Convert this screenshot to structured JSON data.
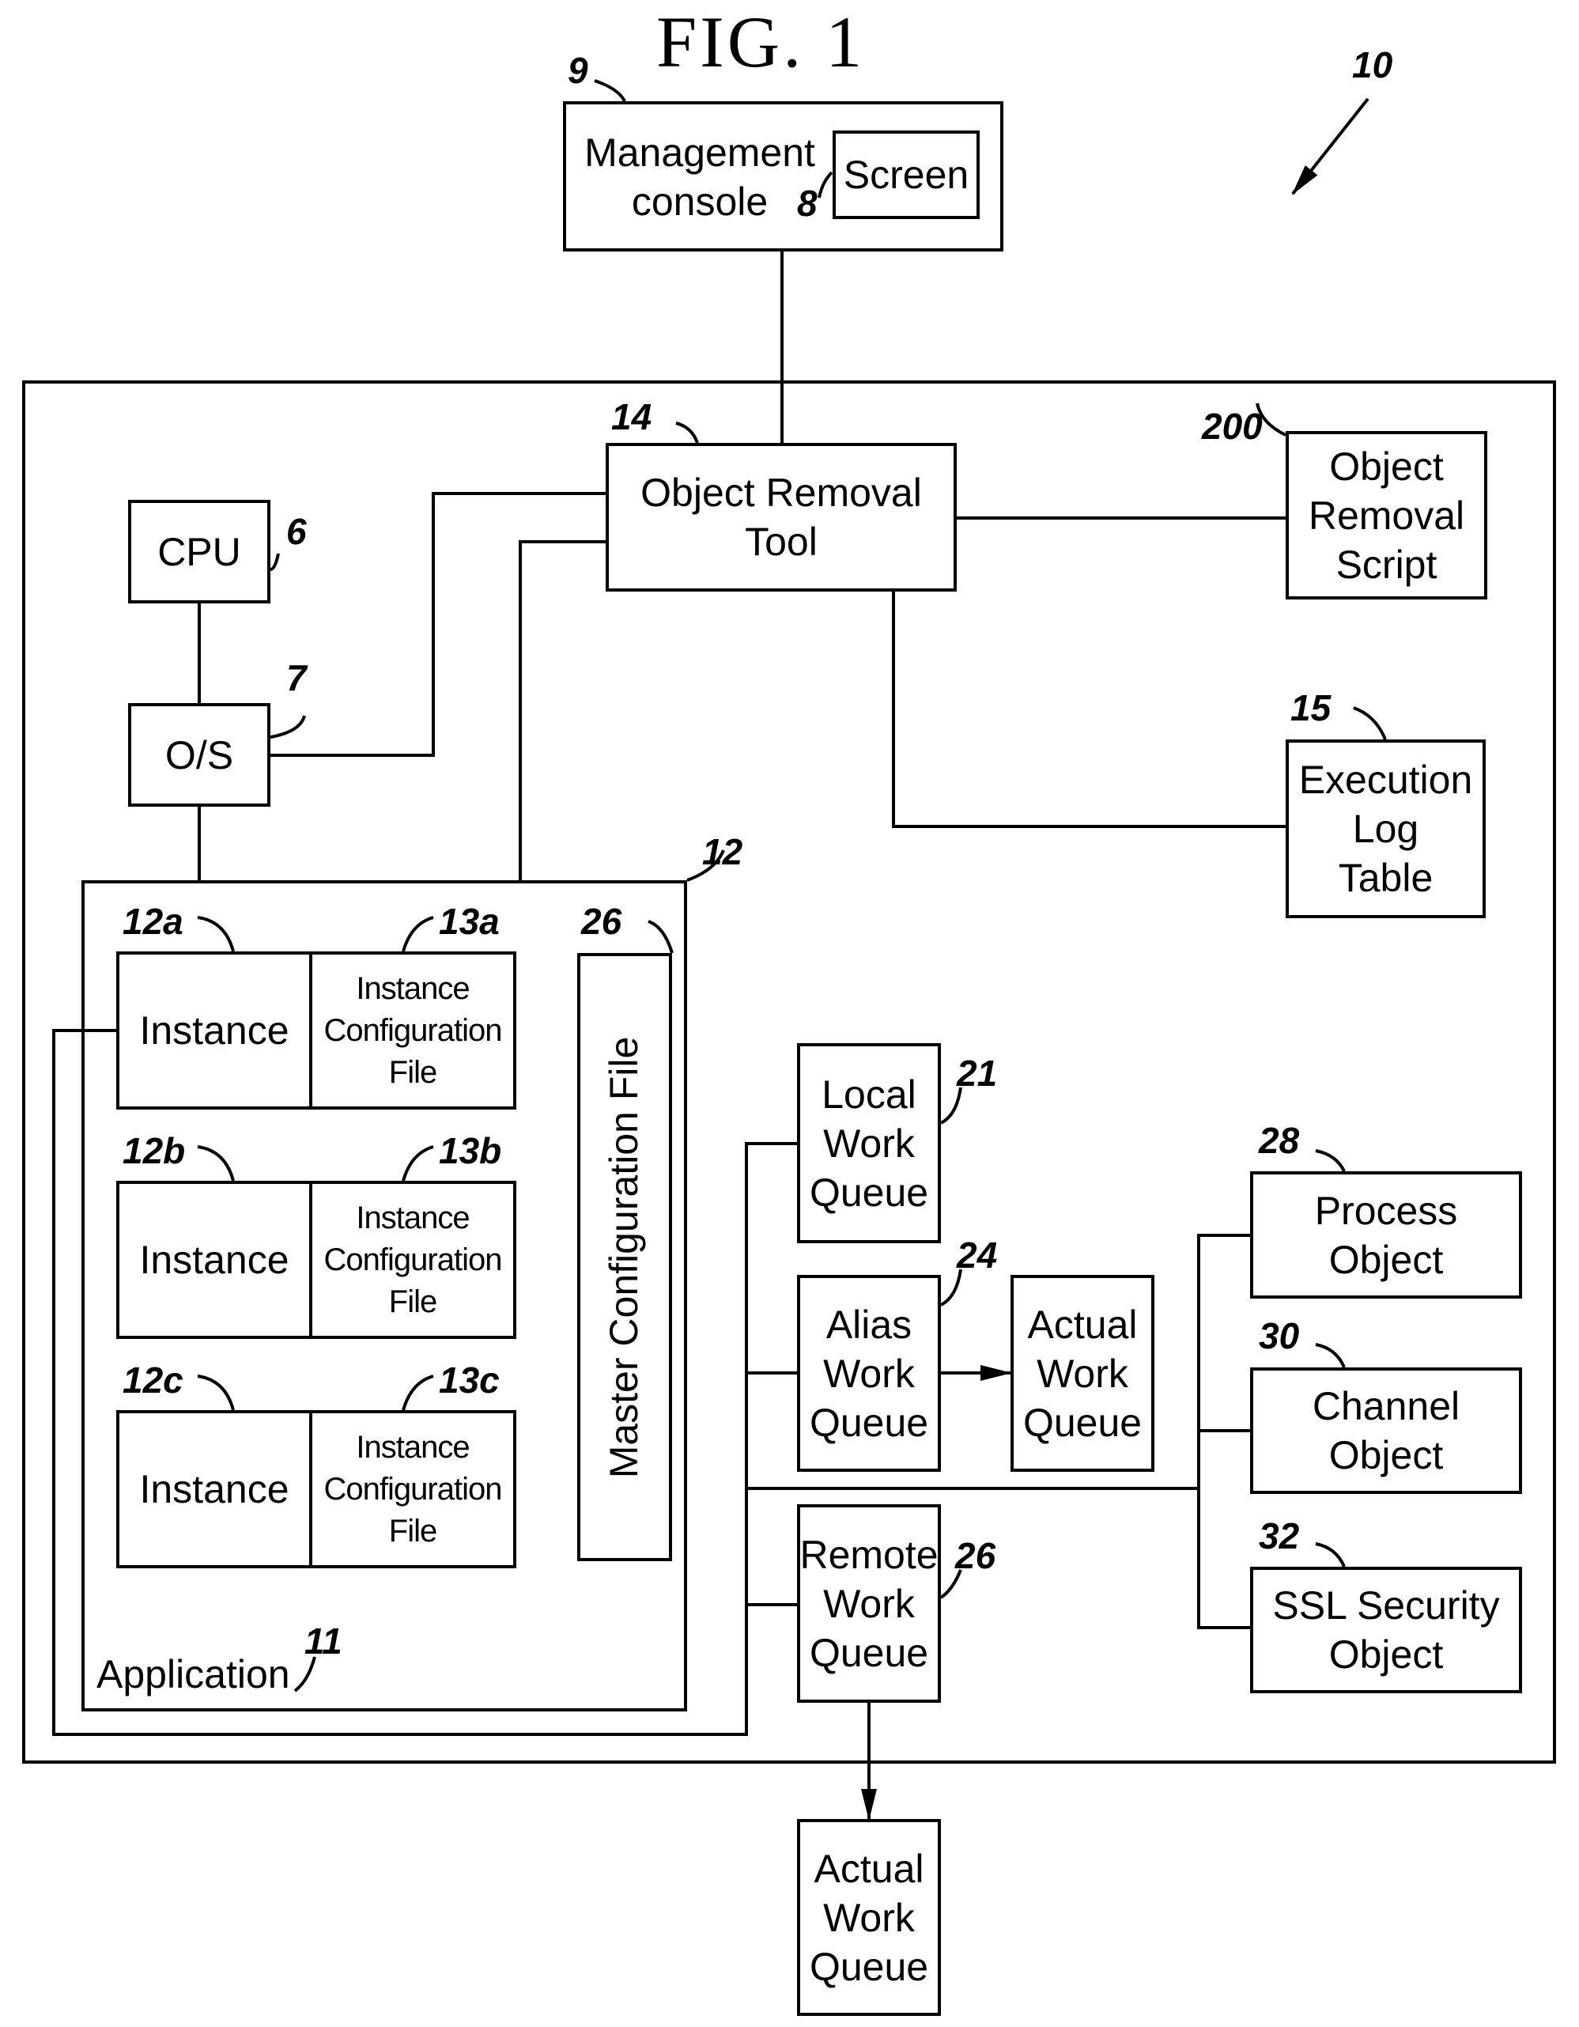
{
  "figure": {
    "title": "FIG. 1",
    "system_ref": "10"
  },
  "management_console": {
    "label": "Management\nconsole",
    "ref": "9",
    "screen": {
      "label": "Screen",
      "ref": "8"
    }
  },
  "object_removal_tool": {
    "label": "Object Removal\nTool",
    "ref": "14"
  },
  "object_removal_script": {
    "label": "Object\nRemoval\nScript",
    "ref": "200"
  },
  "execution_log_table": {
    "label": "Execution\nLog\nTable",
    "ref": "15"
  },
  "cpu": {
    "label": "CPU",
    "ref": "6"
  },
  "os": {
    "label": "O/S",
    "ref": "7"
  },
  "application": {
    "label": "Application",
    "label_ref": "11",
    "ref": "12",
    "instances": [
      {
        "label": "Instance",
        "ref": "12a",
        "config_label": "Instance\nConfiguration\nFile",
        "config_ref": "13a"
      },
      {
        "label": "Instance",
        "ref": "12b",
        "config_label": "Instance\nConfiguration\nFile",
        "config_ref": "13b"
      },
      {
        "label": "Instance",
        "ref": "12c",
        "config_label": "Instance\nConfiguration\nFile",
        "config_ref": "13c"
      }
    ],
    "master_config": {
      "label": "Master Configuration File",
      "ref": "26"
    }
  },
  "queues": {
    "local": {
      "label": "Local\nWork\nQueue",
      "ref": "21"
    },
    "alias": {
      "label": "Alias\nWork\nQueue",
      "ref": "24"
    },
    "alias_target": {
      "label": "Actual\nWork\nQueue"
    },
    "remote": {
      "label": "Remote\nWork\nQueue",
      "ref": "26"
    },
    "remote_target": {
      "label": "Actual\nWork\nQueue"
    }
  },
  "objects": {
    "process": {
      "label": "Process\nObject",
      "ref": "28"
    },
    "channel": {
      "label": "Channel\nObject",
      "ref": "30"
    },
    "ssl": {
      "label": "SSL Security\nObject",
      "ref": "32"
    }
  }
}
